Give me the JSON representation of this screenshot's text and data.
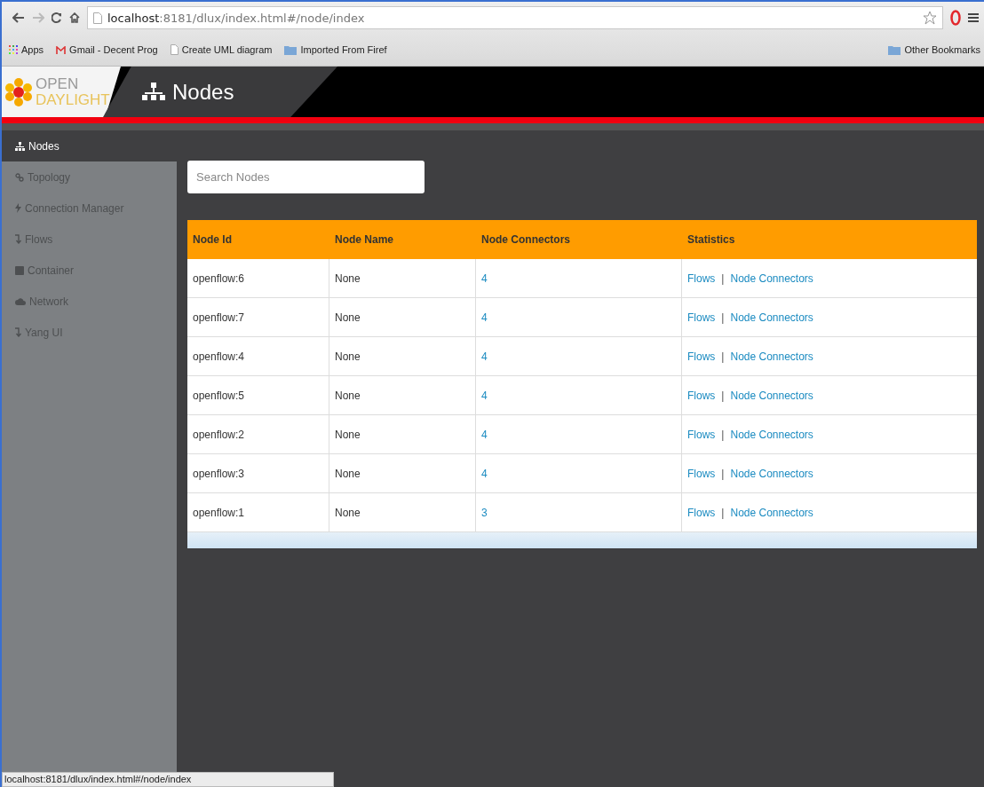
{
  "browser": {
    "address": "**localhost**:8181/dlux/index.html#/node/index",
    "bookmarks": [
      {
        "kind": "apps",
        "label": "Apps"
      },
      {
        "kind": "mail",
        "label": "Gmail - Decent Prog"
      },
      {
        "kind": "page",
        "label": "Create UML diagram"
      },
      {
        "kind": "folder",
        "label": "Imported From Firef"
      }
    ],
    "other_bookmarks": "Other Bookmarks"
  },
  "app": {
    "logo": [
      "OPEN",
      "DAYLIGHT"
    ],
    "title": "Nodes"
  },
  "sidebar": {
    "items": [
      {
        "kind": "nodes",
        "label": "Nodes",
        "selected": true
      },
      {
        "kind": "topology",
        "label": "Topology",
        "selected": false
      },
      {
        "kind": "connection",
        "label": "Connection Manager",
        "selected": false
      },
      {
        "kind": "flows",
        "label": "Flows",
        "selected": false
      },
      {
        "kind": "container",
        "label": "Container",
        "selected": false
      },
      {
        "kind": "network",
        "label": "Network",
        "selected": false
      },
      {
        "kind": "flows",
        "label": "Yang UI",
        "selected": false
      }
    ]
  },
  "search": {
    "placeholder": "Search Nodes"
  },
  "table": {
    "columns": [
      "Node Id",
      "Node Name",
      "Node Connectors",
      "Statistics"
    ],
    "rows": [
      {
        "id": "openflow:6",
        "name": "None",
        "connectors": "4",
        "stats": [
          "Flows",
          "|",
          "Node Connectors"
        ]
      },
      {
        "id": "openflow:7",
        "name": "None",
        "connectors": "4",
        "stats": [
          "Flows",
          "|",
          "Node Connectors"
        ]
      },
      {
        "id": "openflow:4",
        "name": "None",
        "connectors": "4",
        "stats": [
          "Flows",
          "|",
          "Node Connectors"
        ]
      },
      {
        "id": "openflow:5",
        "name": "None",
        "connectors": "4",
        "stats": [
          "Flows",
          "|",
          "Node Connectors"
        ]
      },
      {
        "id": "openflow:2",
        "name": "None",
        "connectors": "4",
        "stats": [
          "Flows",
          "|",
          "Node Connectors"
        ]
      },
      {
        "id": "openflow:3",
        "name": "None",
        "connectors": "4",
        "stats": [
          "Flows",
          "|",
          "Node Connectors"
        ]
      },
      {
        "id": "openflow:1",
        "name": "None",
        "connectors": "3",
        "stats": [
          "Flows",
          "|",
          "Node Connectors"
        ]
      }
    ]
  },
  "status_bar": "localhost:8181/dlux/index.html#/node/index"
}
